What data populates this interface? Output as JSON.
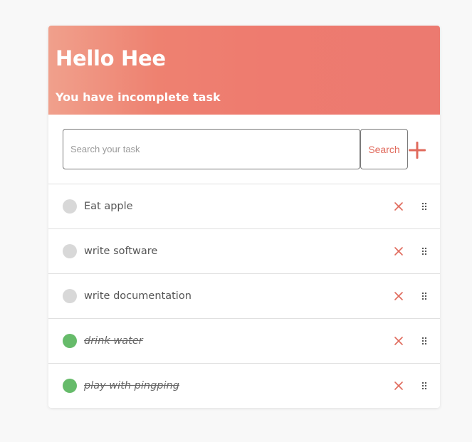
{
  "header": {
    "greeting": "Hello Hee",
    "subtitle": "You have incomplete task"
  },
  "search": {
    "placeholder": "Search your task",
    "value": "",
    "button_label": "Search"
  },
  "add_button_icon": "plus-icon",
  "tasks": [
    {
      "label": "Eat apple",
      "done": false
    },
    {
      "label": "write software",
      "done": false
    },
    {
      "label": "write documentation",
      "done": false
    },
    {
      "label": "drink water",
      "done": true
    },
    {
      "label": "play with pingping",
      "done": true
    }
  ],
  "colors": {
    "header_gradient_start": "#f0a08c",
    "header_gradient_end": "#ec7a70",
    "accent": "#e06a5c",
    "done_status": "#66bb6a",
    "pending_status": "#d8d8d8"
  }
}
